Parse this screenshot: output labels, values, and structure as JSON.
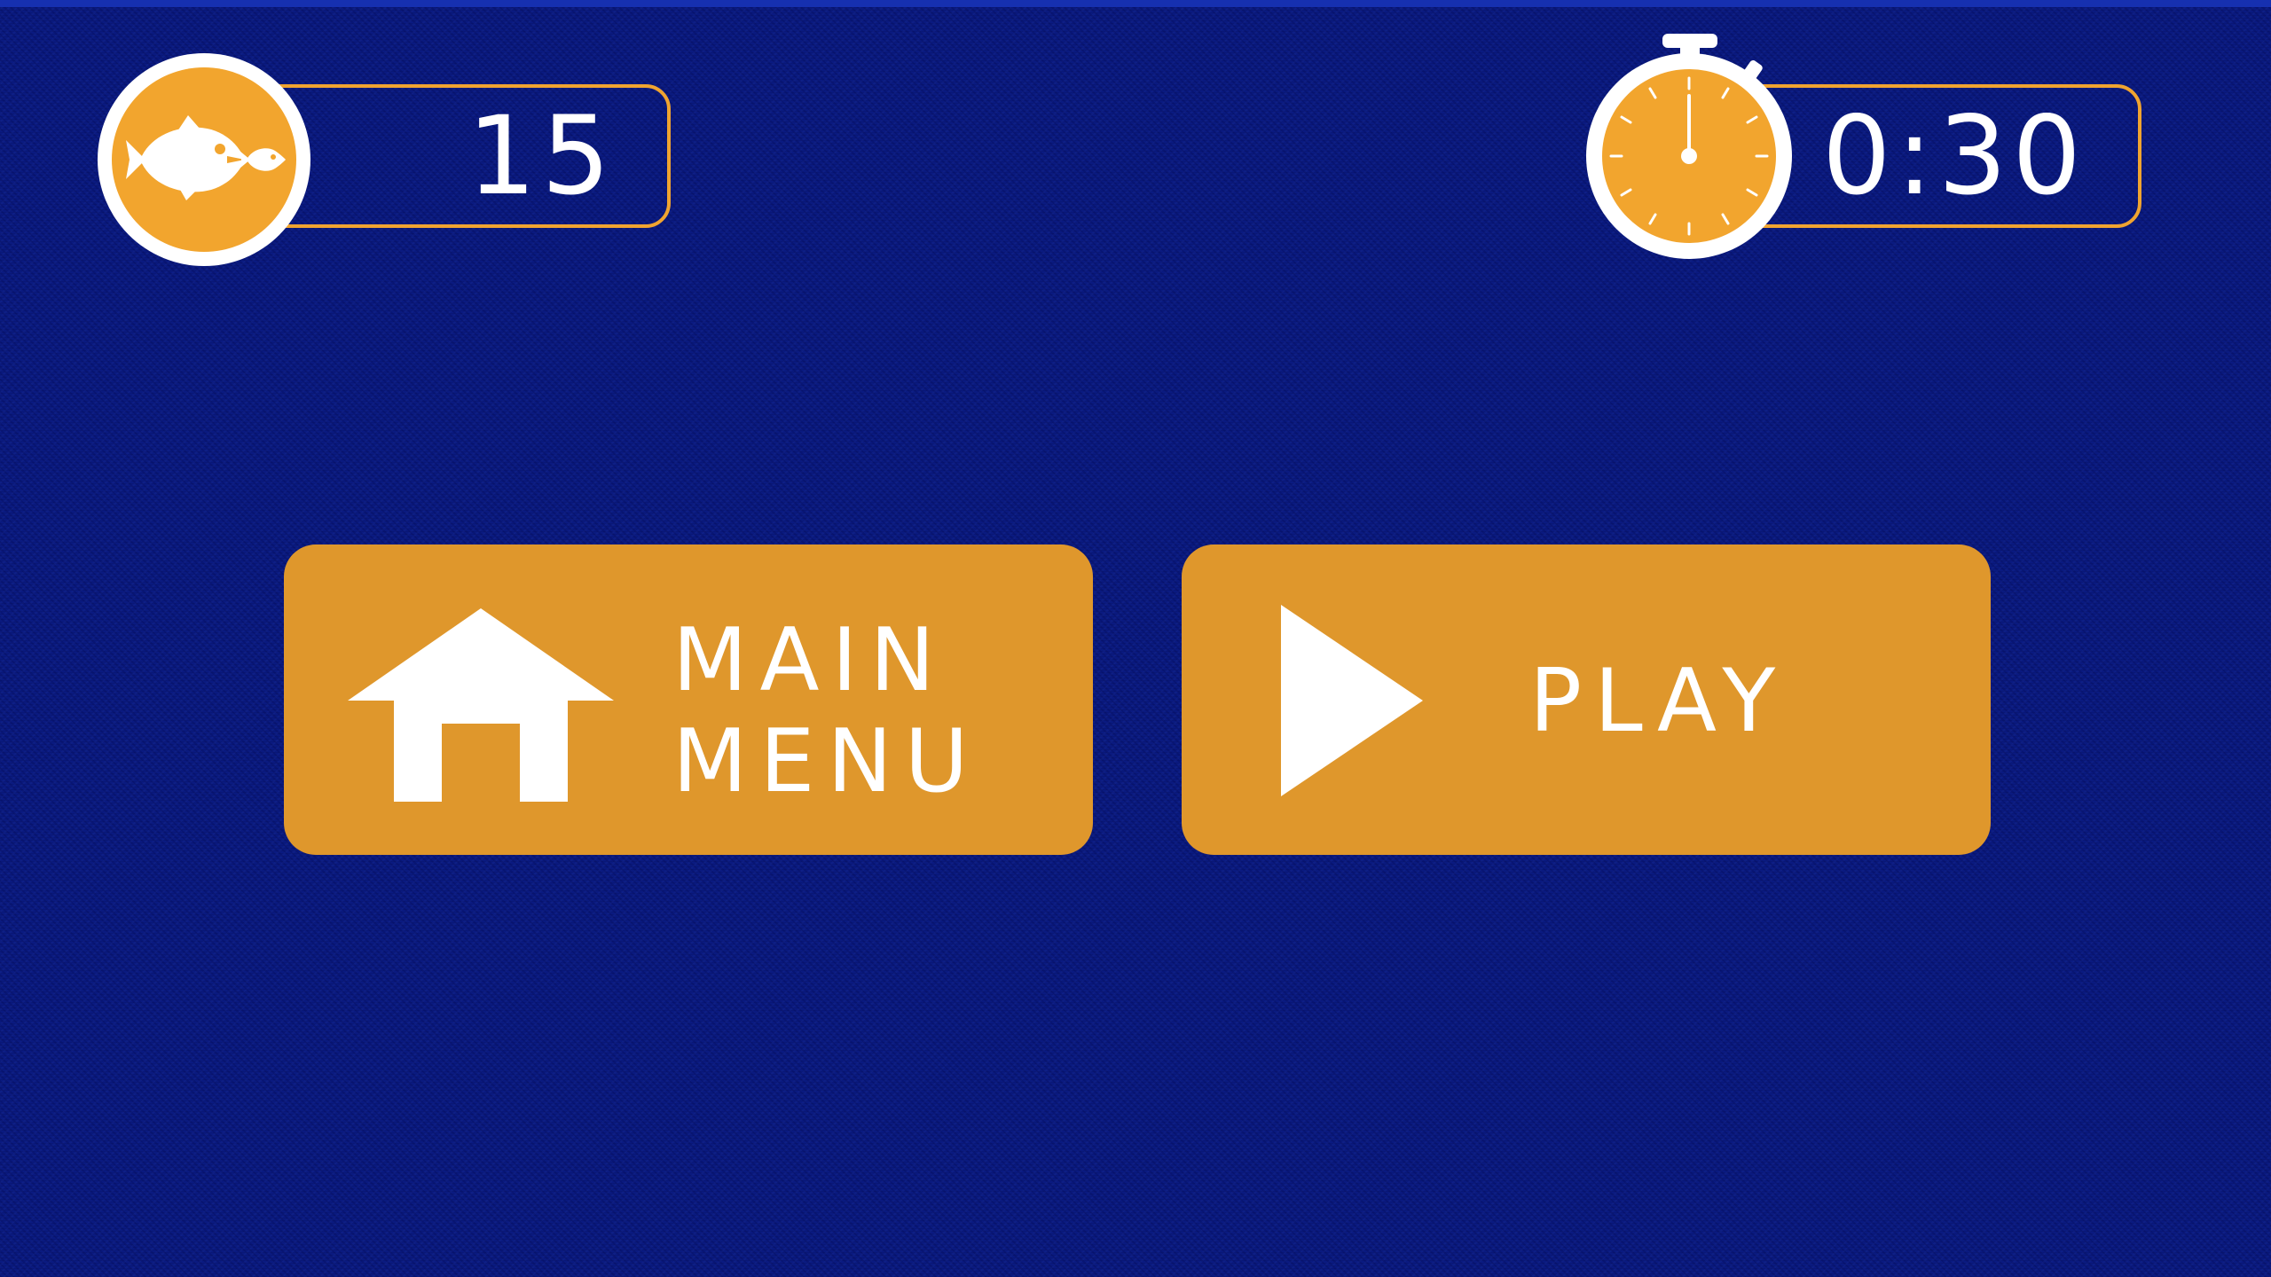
{
  "hud": {
    "score": {
      "icon": "fish-icon",
      "value": "15"
    },
    "timer": {
      "icon": "stopwatch-icon",
      "value": "0:30"
    }
  },
  "buttons": {
    "main_menu": {
      "icon": "home-icon",
      "label_line_1": "MAIN",
      "label_line_2": "MENU"
    },
    "play": {
      "icon": "play-icon",
      "label": "PLAY"
    }
  },
  "colors": {
    "background": "#0a1a80",
    "accent": "#f2a52e",
    "button": "#df972c",
    "text": "#ffffff"
  }
}
